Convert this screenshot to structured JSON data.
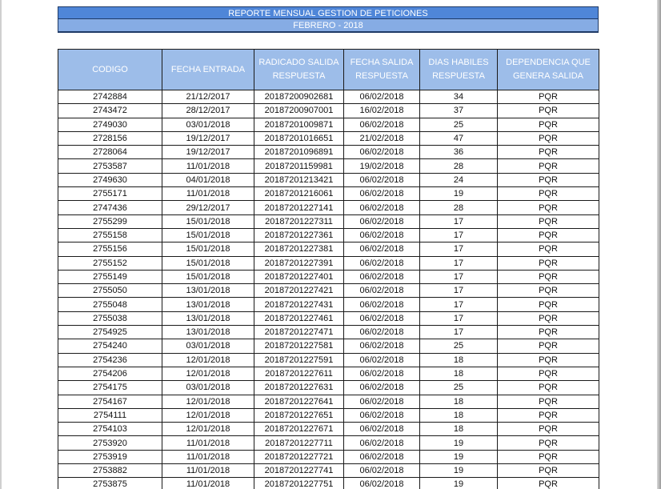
{
  "report": {
    "title": "REPORTE MENSUAL GESTION DE PETICIONES",
    "subtitle": "FEBRERO - 2018"
  },
  "table": {
    "headers": [
      "CODIGO",
      "FECHA ENTRADA",
      "RADICADO SALIDA RESPUESTA",
      "FECHA SALIDA RESPUESTA",
      "DIAS HABILES RESPUESTA",
      "DEPENDENCIA QUE GENERA SALIDA"
    ],
    "rows": [
      [
        "2742884",
        "21/12/2017",
        "20187200902681",
        "06/02/2018",
        "34",
        "PQR"
      ],
      [
        "2743472",
        "28/12/2017",
        "20187200907001",
        "16/02/2018",
        "37",
        "PQR"
      ],
      [
        "2749030",
        "03/01/2018",
        "20187201009871",
        "06/02/2018",
        "25",
        "PQR"
      ],
      [
        "2728156",
        "19/12/2017",
        "20187201016651",
        "21/02/2018",
        "47",
        "PQR"
      ],
      [
        "2728064",
        "19/12/2017",
        "20187201096891",
        "06/02/2018",
        "36",
        "PQR"
      ],
      [
        "2753587",
        "11/01/2018",
        "20187201159981",
        "19/02/2018",
        "28",
        "PQR"
      ],
      [
        "2749630",
        "04/01/2018",
        "20187201213421",
        "06/02/2018",
        "24",
        "PQR"
      ],
      [
        "2755171",
        "11/01/2018",
        "20187201216061",
        "06/02/2018",
        "19",
        "PQR"
      ],
      [
        "2747436",
        "29/12/2017",
        "20187201227141",
        "06/02/2018",
        "28",
        "PQR"
      ],
      [
        "2755299",
        "15/01/2018",
        "20187201227311",
        "06/02/2018",
        "17",
        "PQR"
      ],
      [
        "2755158",
        "15/01/2018",
        "20187201227361",
        "06/02/2018",
        "17",
        "PQR"
      ],
      [
        "2755156",
        "15/01/2018",
        "20187201227381",
        "06/02/2018",
        "17",
        "PQR"
      ],
      [
        "2755152",
        "15/01/2018",
        "20187201227391",
        "06/02/2018",
        "17",
        "PQR"
      ],
      [
        "2755149",
        "15/01/2018",
        "20187201227401",
        "06/02/2018",
        "17",
        "PQR"
      ],
      [
        "2755050",
        "13/01/2018",
        "20187201227421",
        "06/02/2018",
        "17",
        "PQR"
      ],
      [
        "2755048",
        "13/01/2018",
        "20187201227431",
        "06/02/2018",
        "17",
        "PQR"
      ],
      [
        "2755038",
        "13/01/2018",
        "20187201227461",
        "06/02/2018",
        "17",
        "PQR"
      ],
      [
        "2754925",
        "13/01/2018",
        "20187201227471",
        "06/02/2018",
        "17",
        "PQR"
      ],
      [
        "2754240",
        "03/01/2018",
        "20187201227581",
        "06/02/2018",
        "25",
        "PQR"
      ],
      [
        "2754236",
        "12/01/2018",
        "20187201227591",
        "06/02/2018",
        "18",
        "PQR"
      ],
      [
        "2754206",
        "12/01/2018",
        "20187201227611",
        "06/02/2018",
        "18",
        "PQR"
      ],
      [
        "2754175",
        "03/01/2018",
        "20187201227631",
        "06/02/2018",
        "25",
        "PQR"
      ],
      [
        "2754167",
        "12/01/2018",
        "20187201227641",
        "06/02/2018",
        "18",
        "PQR"
      ],
      [
        "2754111",
        "12/01/2018",
        "20187201227651",
        "06/02/2018",
        "18",
        "PQR"
      ],
      [
        "2754103",
        "12/01/2018",
        "20187201227671",
        "06/02/2018",
        "18",
        "PQR"
      ],
      [
        "2753920",
        "11/01/2018",
        "20187201227711",
        "06/02/2018",
        "19",
        "PQR"
      ],
      [
        "2753919",
        "11/01/2018",
        "20187201227721",
        "06/02/2018",
        "19",
        "PQR"
      ],
      [
        "2753882",
        "11/01/2018",
        "20187201227741",
        "06/02/2018",
        "19",
        "PQR"
      ],
      [
        "2753875",
        "11/01/2018",
        "20187201227751",
        "06/02/2018",
        "19",
        "PQR"
      ]
    ]
  }
}
